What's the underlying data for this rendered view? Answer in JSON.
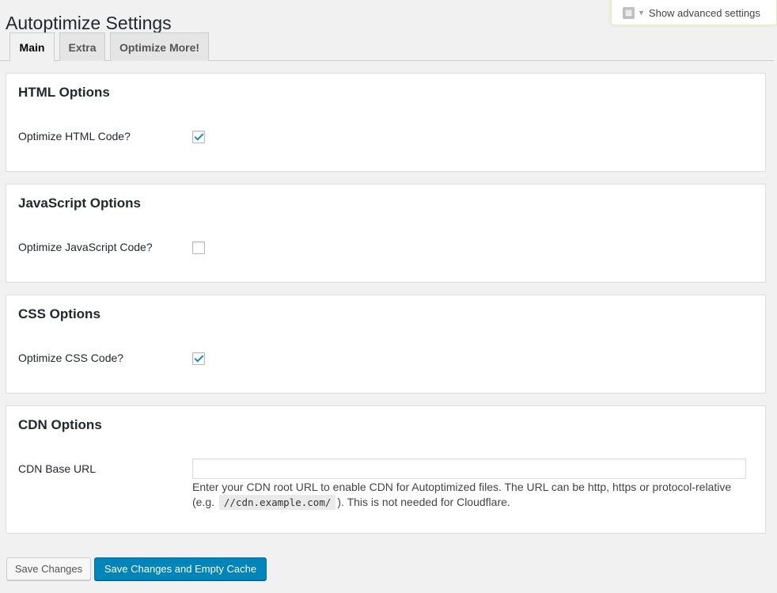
{
  "page": {
    "title": "Autoptimize Settings",
    "advanced_toggle_label": "Show advanced settings"
  },
  "tabs": [
    {
      "label": "Main",
      "active": true
    },
    {
      "label": "Extra",
      "active": false
    },
    {
      "label": "Optimize More!",
      "active": false
    }
  ],
  "sections": {
    "html": {
      "title": "HTML Options",
      "option_label": "Optimize HTML Code?",
      "checked": true
    },
    "js": {
      "title": "JavaScript Options",
      "option_label": "Optimize JavaScript Code?",
      "checked": false
    },
    "css": {
      "title": "CSS Options",
      "option_label": "Optimize CSS Code?",
      "checked": true
    },
    "cdn": {
      "title": "CDN Options",
      "option_label": "CDN Base URL",
      "input_value": "",
      "desc_before": "Enter your CDN root URL to enable CDN for Autoptimized files. The URL can be http, https or protocol-relative (e.g. ",
      "desc_code": "//cdn.example.com/",
      "desc_after": "). This is not needed for Cloudflare."
    }
  },
  "buttons": {
    "save": "Save Changes",
    "save_empty_cache": "Save Changes and Empty Cache"
  },
  "colors": {
    "primary_button": "#0085ba",
    "checkmark": "#1e8cbe",
    "background": "#f1f1f1"
  }
}
